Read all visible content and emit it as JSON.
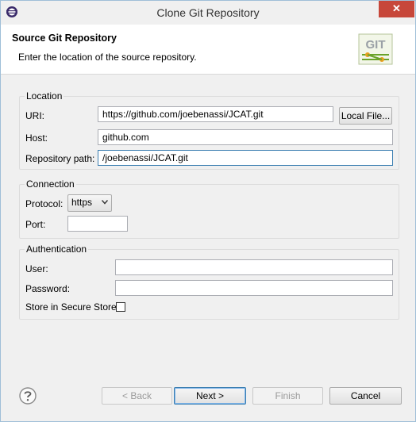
{
  "window": {
    "title": "Clone Git Repository",
    "close_glyph": "✕"
  },
  "banner": {
    "title": "Source Git Repository",
    "description": "Enter the location of the source repository.",
    "icon_text": "GIT"
  },
  "location": {
    "legend": "Location",
    "uri_label": "URI:",
    "uri_value": "https://github.com/joebenassi/JCAT.git",
    "local_file_button": "Local File...",
    "host_label": "Host:",
    "host_value": "github.com",
    "repo_path_label": "Repository path:",
    "repo_path_value": "/joebenassi/JCAT.git"
  },
  "connection": {
    "legend": "Connection",
    "protocol_label": "Protocol:",
    "protocol_value": "https",
    "port_label": "Port:",
    "port_value": ""
  },
  "authentication": {
    "legend": "Authentication",
    "user_label": "User:",
    "user_value": "",
    "password_label": "Password:",
    "password_value": "",
    "secure_store_label": "Store in Secure Store",
    "secure_store_checked": false
  },
  "footer": {
    "back_button": "< Back",
    "next_button": "Next >",
    "finish_button": "Finish",
    "cancel_button": "Cancel"
  },
  "colors": {
    "close_button": "#c7473a",
    "focus_border": "#3c7fb1"
  }
}
